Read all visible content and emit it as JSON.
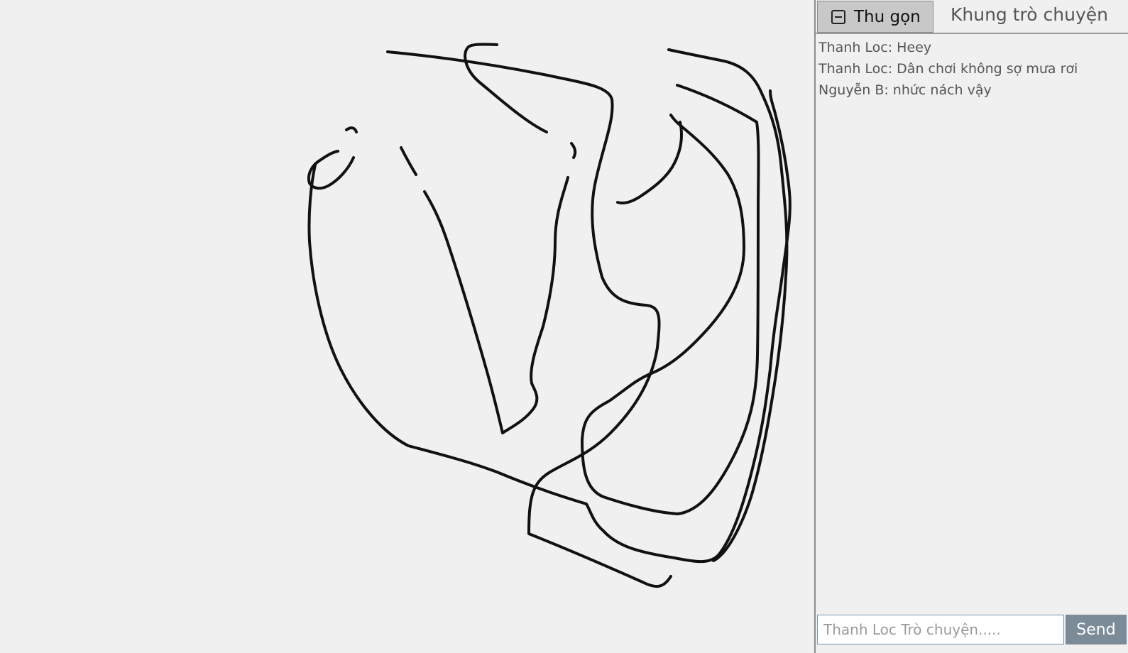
{
  "chat": {
    "collapse_label": "Thu gọn",
    "title": "Khung trò chuyện",
    "messages": [
      "Thanh Loc: Heey",
      "Thanh Loc: Dân chơi không sợ mưa rơi",
      "Nguyễn B: nhức nách vậy"
    ],
    "input_placeholder": "Thanh Loc Trò chuyện.....",
    "input_value": "",
    "send_label": "Send"
  },
  "icons": {
    "collapse": "minus-square-icon"
  },
  "colors": {
    "background": "#f0f0f0",
    "stroke": "#111111",
    "collapse_button": "#c8c8c8",
    "send_button": "#7b8b98"
  }
}
